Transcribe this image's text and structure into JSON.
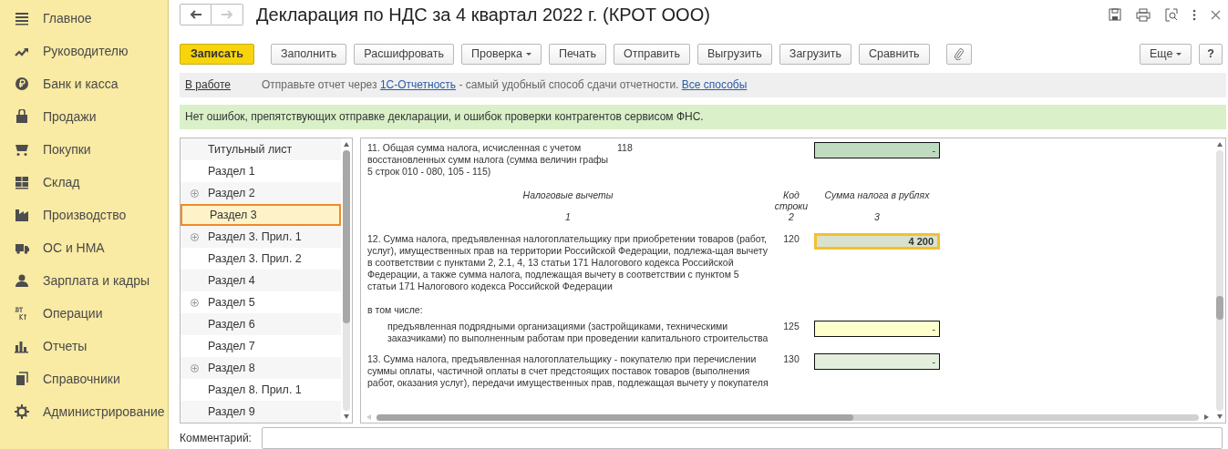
{
  "sidebar": {
    "items": [
      {
        "label": "Главное",
        "selected": false
      },
      {
        "label": "Руководителю",
        "selected": false
      },
      {
        "label": "Банк и касса",
        "selected": false
      },
      {
        "label": "Продажи",
        "selected": false
      },
      {
        "label": "Покупки",
        "selected": false
      },
      {
        "label": "Склад",
        "selected": false
      },
      {
        "label": "Производство",
        "selected": false
      },
      {
        "label": "ОС и НМА",
        "selected": false
      },
      {
        "label": "Зарплата и кадры",
        "selected": false
      },
      {
        "label": "Операции",
        "selected": false
      },
      {
        "label": "Отчеты",
        "selected": false
      },
      {
        "label": "Справочники",
        "selected": false
      },
      {
        "label": "Администрирование",
        "selected": false
      }
    ]
  },
  "window": {
    "title": "Декларация по НДС за 4 квартал 2022 г. (КРОТ ООО)",
    "back_disabled": false,
    "forward_disabled": true
  },
  "toolbar": {
    "buttons": [
      {
        "label": "Записать",
        "kind": "primary"
      },
      {
        "label": "Заполнить",
        "kind": "plain"
      },
      {
        "label": "Расшифровать",
        "kind": "plain"
      },
      {
        "label": "Проверка",
        "kind": "menu"
      },
      {
        "label": "Печать",
        "kind": "plain"
      },
      {
        "label": "Отправить",
        "kind": "plain"
      },
      {
        "label": "Выгрузить",
        "kind": "plain"
      },
      {
        "label": "Загрузить",
        "kind": "plain"
      },
      {
        "label": "Сравнить",
        "kind": "plain"
      },
      {
        "kind": "attach"
      }
    ],
    "right_buttons": [
      {
        "label": "Еще",
        "kind": "menu"
      },
      {
        "label": "?",
        "kind": "help"
      }
    ]
  },
  "info_bar": {
    "status": "В работе",
    "text_before": "Отправьте отчет через",
    "link": "1С-Отчетность",
    "text_after": "- самый удобный способ сдачи отчетности.",
    "link_all": "Все способы"
  },
  "check_message": "Нет ошибок, препятствующих отправке декларации, и ошибок проверки контрагентов сервисом ФНС.",
  "tree": {
    "items": [
      {
        "label": "Титульный лист",
        "expandable": false,
        "selected": false
      },
      {
        "label": "Раздел 1",
        "expandable": false,
        "selected": false
      },
      {
        "label": "Раздел 2",
        "expandable": true,
        "selected": false
      },
      {
        "label": "Раздел 3",
        "expandable": false,
        "selected": true
      },
      {
        "label": "Раздел 3. Прил. 1",
        "expandable": true,
        "selected": false
      },
      {
        "label": "Раздел 3. Прил. 2",
        "expandable": false,
        "selected": false
      },
      {
        "label": "Раздел 4",
        "expandable": false,
        "selected": false
      },
      {
        "label": "Раздел 5",
        "expandable": true,
        "selected": false
      },
      {
        "label": "Раздел 6",
        "expandable": false,
        "selected": false
      },
      {
        "label": "Раздел 7",
        "expandable": false,
        "selected": false
      },
      {
        "label": "Раздел 8",
        "expandable": true,
        "selected": false
      },
      {
        "label": "Раздел 8. Прил. 1",
        "expandable": false,
        "selected": false
      },
      {
        "label": "Раздел 9",
        "expandable": false,
        "selected": false
      }
    ]
  },
  "form": {
    "rows": [
      {
        "kind": "line",
        "text": "11. Общая сумма налога, исчисленная с учетом восстановленных сумм налога (сумма величин графы 5 строк 010 - 080, 105 - 115)",
        "code": "118",
        "value": "-",
        "color": "#c0dcc0",
        "selected": false
      },
      {
        "kind": "header",
        "text": "Налоговые вычеты",
        "code": "Код строки",
        "value": "Сумма налога в рублях"
      },
      {
        "kind": "numbers",
        "text": "1",
        "code": "2",
        "value": "3"
      },
      {
        "kind": "line",
        "text": "12. Сумма налога, предъявленная налогоплательщику при приобретении товаров (работ, услуг), имущественных прав на территории Российской Федерации, подлежа-щая вычету в соответствии с пунктами 2, 2.1, 4, 13 статьи 171 Налогового кодекса Российской Федерации, а также сумма налога, подлежащая вычету в соответствии с пунктом 5 статьи 171 Налогового кодекса Российской Федерации",
        "code": "120",
        "value": "4 200",
        "color": "#d9e1cf",
        "selected": true
      },
      {
        "kind": "note",
        "text": "в том числе:"
      },
      {
        "kind": "subline",
        "text": "предъявленная подрядными организациями (застройщиками, техническими заказчиками) по выполненным работам при проведении капитального строительства",
        "code": "125",
        "value": "-",
        "color": "#ffffcc",
        "selected": false
      },
      {
        "kind": "line",
        "text": "13. Сумма налога, предъявленная налогоплательщику - покупателю при перечислении суммы оплаты, частичной оплаты в счет предстоящих поставок товаров (выполнения работ, оказания услуг), передачи имущественных прав, подлежащая вычету у покупателя",
        "code": "130",
        "value": "-",
        "color": "#e3eedc",
        "selected": false
      }
    ]
  },
  "comment": {
    "label": "Комментарий:"
  }
}
